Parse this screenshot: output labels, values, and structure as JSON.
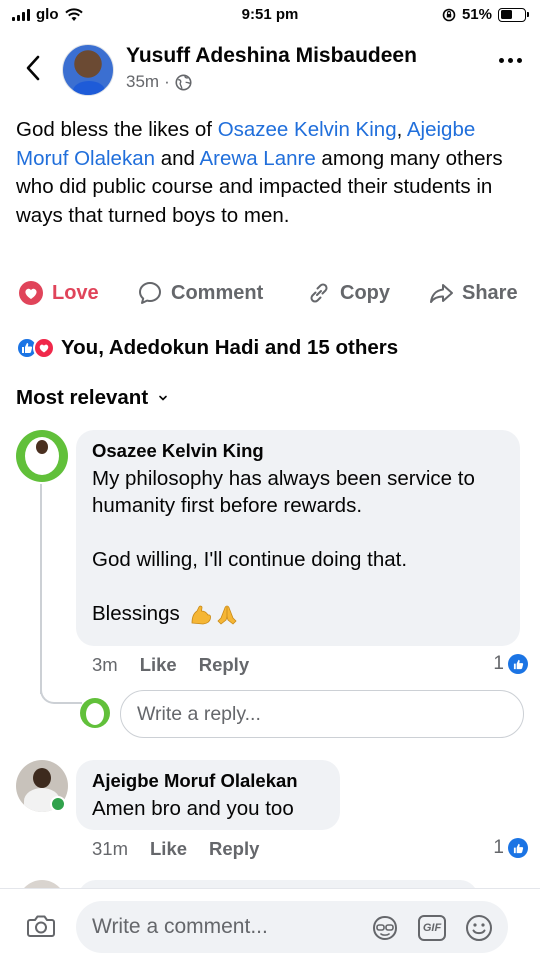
{
  "status_bar": {
    "carrier": "glo",
    "time": "9:51 pm",
    "battery": "51%",
    "battery_level": 0.51
  },
  "post": {
    "author": "Yusuff Adeshina Misbaudeen",
    "time": "35m",
    "separator": "·",
    "audience_icon": "globe-icon",
    "text_parts": {
      "t1": "God bless the likes of ",
      "m1": "Osazee Kelvin King",
      "t2": ", ",
      "m2": "Ajeigbe Moruf Olalekan",
      "t3": " and ",
      "m3": "Arewa Lanre",
      "t4": " among many others who did public course and impacted their students in ways that turned boys to men."
    }
  },
  "actions": {
    "love": "Love",
    "comment": "Comment",
    "copy": "Copy",
    "share": "Share"
  },
  "reactions": {
    "summary": "You, Adedokun Hadi and 15 others",
    "icons": [
      "like-icon",
      "love-icon"
    ]
  },
  "sort": {
    "label": "Most relevant"
  },
  "comments": [
    {
      "name": "Osazee Kelvin King",
      "line1": "My philosophy has always been service to humanity first before rewards.",
      "line2": "God willing, I'll continue doing that.",
      "line3": "Blessings",
      "emojis": [
        "flexed-biceps-emoji",
        "folded-hands-emoji"
      ],
      "time": "3m",
      "like": "Like",
      "reply": "Reply",
      "like_count": "1"
    },
    {
      "name": "Ajeigbe Moruf Olalekan",
      "text": "Amen bro and you too",
      "time": "31m",
      "like": "Like",
      "reply": "Reply",
      "like_count": "1"
    }
  ],
  "reply_input": {
    "placeholder": "Write a reply..."
  },
  "composer": {
    "placeholder": "Write a comment...",
    "gif_label": "GIF"
  },
  "colors": {
    "mention": "#216fdb",
    "love": "#e0445a",
    "like": "#1b74e4",
    "bubble": "#f0f2f5"
  }
}
